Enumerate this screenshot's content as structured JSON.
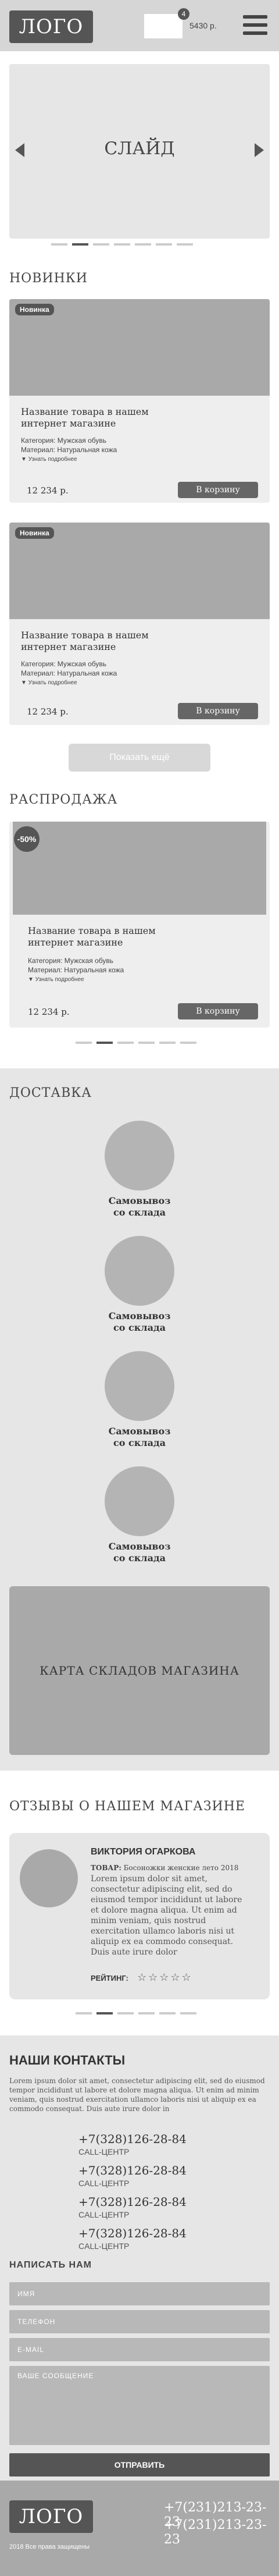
{
  "header": {
    "logo": "ЛОГО",
    "cart_count": "4",
    "cart_sum": "5430 р."
  },
  "slider": {
    "label": "СЛАЙД"
  },
  "new_section": {
    "title": "НОВИНКИ",
    "show_more": "Показать ещё"
  },
  "products": [
    {
      "badge": "Новинка",
      "name": "Название товара в нашем интернет магазине",
      "category": "Категория: Мужская обувь",
      "material": "Материал: Натуральная кожа",
      "more": "▼ Узнать подробнее",
      "price": "12 234 р.",
      "buy": "В корзину"
    },
    {
      "badge": "Новинка",
      "name": "Название товара в нашем интернет магазине",
      "category": "Категория: Мужская обувь",
      "material": "Материал: Натуральная кожа",
      "more": "▼ Узнать подробнее",
      "price": "12 234 р.",
      "buy": "В корзину"
    }
  ],
  "sale_section": {
    "title": "РАСПРОДАЖА",
    "product": {
      "badge": "-50%",
      "name": "Название товара в нашем интернет магазине",
      "category": "Категория: Мужская обувь",
      "material": "Материал: Натуральная кожа",
      "more": "▼ Узнать подробнее",
      "price": "12 234 р.",
      "buy": "В корзину"
    }
  },
  "delivery": {
    "title": "ДОСТАВКА",
    "items": [
      {
        "line1": "Самовывоз",
        "line2": "со склада"
      },
      {
        "line1": "Самовывоз",
        "line2": "со склада"
      },
      {
        "line1": "Самовывоз",
        "line2": "со склада"
      },
      {
        "line1": "Самовывоз",
        "line2": "со склада"
      }
    ],
    "map_label": "КАРТА СКЛАДОВ МАГАЗИНА"
  },
  "reviews": {
    "title": "ОТЗЫВЫ О НАШЕМ МАГАЗИНЕ",
    "name": "ВИКТОРИЯ ОГАРКОВА",
    "product_label": "ТОВАР:",
    "product": "Босоножки женские лето 2018",
    "text": "Lorem ipsum dolor sit amet, consectetur adipiscing elit, sed do eiusmod tempor incididunt ut labore et dolore magna aliqua. Ut enim ad minim veniam, quis nostrud exercitation ullamco laboris nisi ut aliquip ex ea commodo consequat. Duis aute irure dolor",
    "rating_label": "РЕЙТИНГ:",
    "stars": "☆☆☆☆☆"
  },
  "contacts": {
    "title": "НАШИ КОНТАКТЫ",
    "text": "Lorem ipsum dolor sit amet, consectetur adipiscing elit, sed do eiusmod tempor incididunt ut labore et dolore magna aliqua. Ut enim ad minim veniam, quis nostrud exercitation ullamco laboris nisi ut aliquip ex ea commodo consequat. Duis aute irure dolor in",
    "phones": [
      {
        "number": "+7(328)126-28-84",
        "caption": "CALL-ЦЕНТР"
      },
      {
        "number": "+7(328)126-28-84",
        "caption": "CALL-ЦЕНТР"
      },
      {
        "number": "+7(328)126-28-84",
        "caption": "CALL-ЦЕНТР"
      },
      {
        "number": "+7(328)126-28-84",
        "caption": "CALL-ЦЕНТР"
      }
    ],
    "write_title": "НАПИСАТЬ НАМ",
    "name_placeholder": "ИМЯ",
    "phone_placeholder": "ТЕЛЕФОН",
    "email_placeholder": "E-MAIL",
    "message_placeholder": "ВАШЕ СООБЩЕНИЕ",
    "send": "ОТПРАВИТЬ"
  },
  "footer": {
    "logo": "ЛОГО",
    "copyright": "2018 Все права защищены",
    "phones": [
      "+7(231)213-23-23",
      "+7(231)213-23-23"
    ]
  }
}
